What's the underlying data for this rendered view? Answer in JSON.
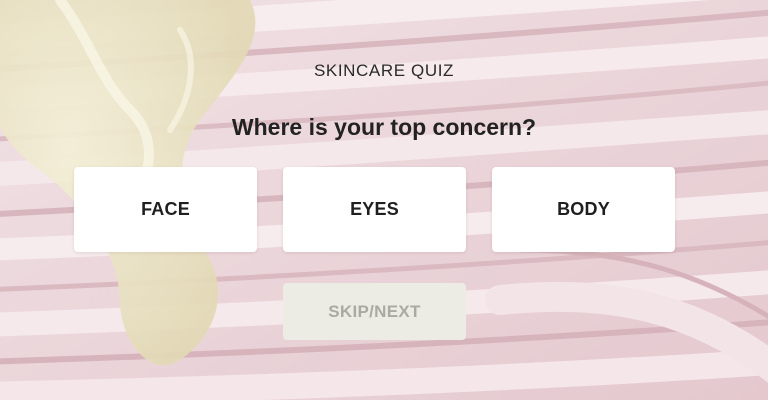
{
  "quiz": {
    "eyebrow": "SKINCARE QUIZ",
    "question": "Where is your top concern?",
    "options": [
      {
        "label": "FACE"
      },
      {
        "label": "EYES"
      },
      {
        "label": "BODY"
      }
    ],
    "skip_label": "SKIP/NEXT"
  },
  "colors": {
    "background_pink": "#e9d3d8",
    "cream_swirl": "#efe9cf",
    "option_bg": "#ffffff",
    "skip_bg": "#ecebe4",
    "skip_text": "#aaa9a4",
    "text_dark": "#222222"
  }
}
